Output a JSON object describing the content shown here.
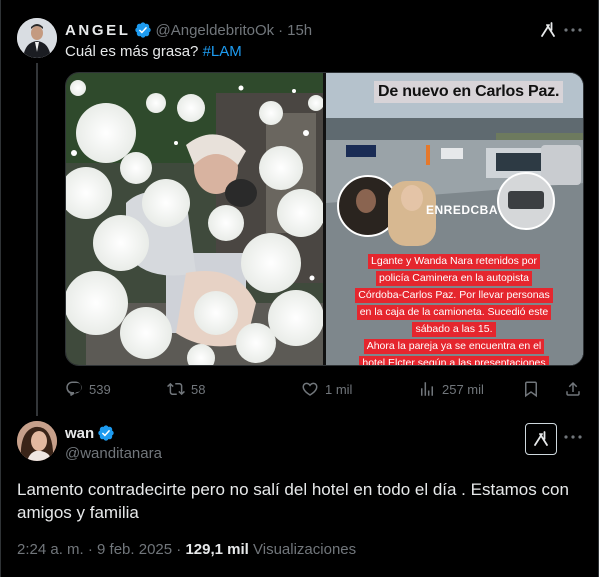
{
  "parent_tweet": {
    "display_name": "ANGEL",
    "handle": "@AngeldebritoOk",
    "separator": "·",
    "time": "15h",
    "text": "Cuál es más grasa?",
    "hashtag": "#LAM",
    "media_right": {
      "headline": "De nuevo en Carlos Paz.",
      "watermark": "ENREDCBA",
      "caption_lines": [
        "Lgante y Wanda Nara retenidos por",
        "policía Caminera en la autopista",
        "Córdoba-Carlos Paz. Por llevar personas",
        "en la caja de la camioneta. Sucedió este",
        "sábado a las 15.",
        "Ahora la pareja ya se encuentra en el",
        "hotel Elcter según a las presentaciones"
      ]
    },
    "actions": {
      "replies": "539",
      "reposts": "58",
      "likes": "1 mil",
      "views": "257 mil"
    }
  },
  "reply_tweet": {
    "display_name": "wan",
    "handle": "@wanditanara",
    "text": "Lamento contradecirte pero no salí del hotel en todo el día . Estamos con amigos y familia",
    "timestamp": "2:24 a. m. · 9 feb. 2025",
    "separator": "·",
    "views_count": "129,1 mil",
    "views_label": "Visualizaciones"
  },
  "colors": {
    "background": "#000000",
    "text_primary": "#e7e9ea",
    "text_secondary": "#71767b",
    "accent": "#1d9bf0",
    "verified": "#1d9bf0"
  }
}
